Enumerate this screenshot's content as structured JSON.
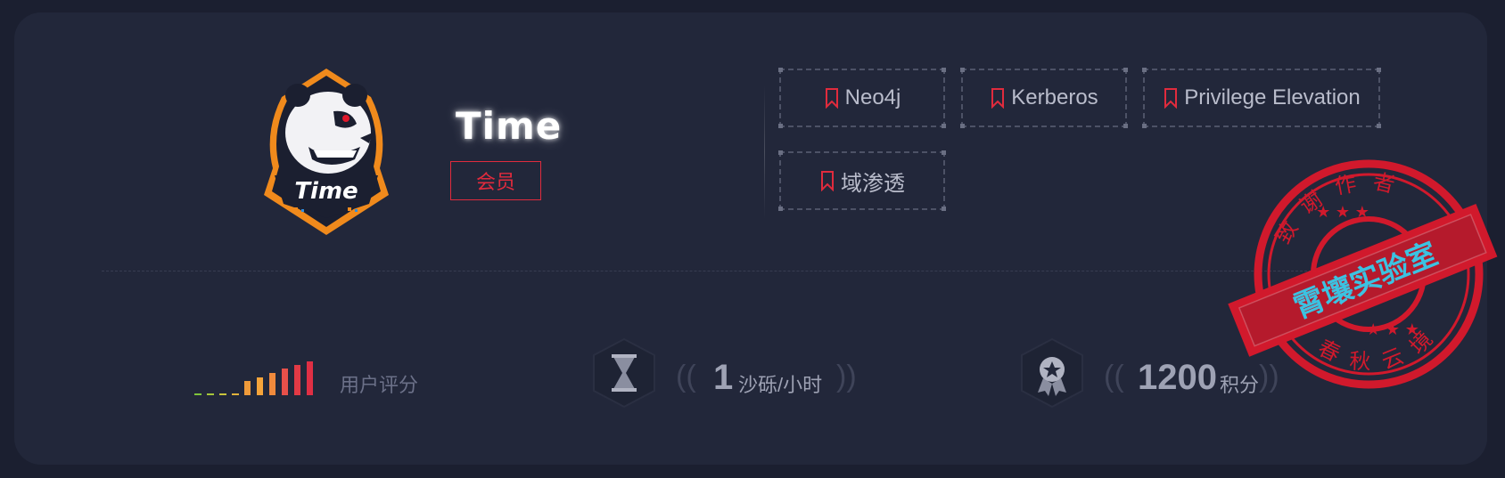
{
  "profile": {
    "name": "Time",
    "avatar_text": "Time",
    "badge": "会员"
  },
  "tags": [
    {
      "label": "Neo4j",
      "icon": "bookmark-icon"
    },
    {
      "label": "Kerberos",
      "icon": "bookmark-icon"
    },
    {
      "label": "Privilege Elevation",
      "icon": "bookmark-icon"
    },
    {
      "label": "域渗透",
      "icon": "bookmark-icon"
    }
  ],
  "rating": {
    "label": "用户评分",
    "bar_colors": [
      "#7ec43a",
      "#a6c63b",
      "#c9c43c",
      "#e2b23c",
      "#ef9a3a",
      "#f6a43a",
      "#f08a3c",
      "#e8504a",
      "#e23a45",
      "#e02f44"
    ],
    "filled_bars": 6,
    "total_bars": 10
  },
  "stats": {
    "sand": {
      "value": "1",
      "unit": "沙砾/小时",
      "icon": "hourglass-icon"
    },
    "points": {
      "value": "1200",
      "unit": "积分",
      "icon": "medal-icon"
    }
  },
  "stamp": {
    "top_text": "致谢作者",
    "bottom_text": "春秋云境",
    "banner": "霄壤实验室",
    "color": "#e0182b",
    "banner_text_color": "#3fd0f0"
  },
  "colors": {
    "accent_red": "#e02b3d",
    "background": "#1b1f30",
    "card": "#22273a"
  }
}
